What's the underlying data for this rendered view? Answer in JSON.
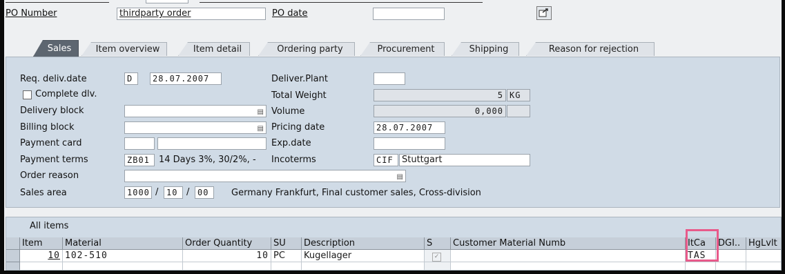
{
  "header": {
    "po_number_label": "PO Number",
    "po_number_value": "thirdparty order",
    "po_date_label": "PO date",
    "po_date_value": "",
    "toolbar_icon": "display-document-icon"
  },
  "tabs": [
    "Sales",
    "Item overview",
    "Item detail",
    "Ordering party",
    "Procurement",
    "Shipping",
    "Reason for rejection"
  ],
  "sales": {
    "req_deliv_date_label": "Req. deliv.date",
    "req_deliv_date_fmt": "D",
    "req_deliv_date_value": "28.07.2007",
    "complete_dlv_label": "Complete dlv.",
    "delivery_block_label": "Delivery block",
    "billing_block_label": "Billing block",
    "payment_card_label": "Payment card",
    "payment_terms_label": "Payment terms",
    "payment_terms_code": "ZB01",
    "payment_terms_text": "14 Days 3%, 30/2%, -",
    "order_reason_label": "Order reason",
    "sales_area_label": "Sales area",
    "sales_org": "1000",
    "distr_channel": "10",
    "division": "00",
    "sep": "/",
    "sales_area_text": "Germany Frankfurt, Final customer sales, Cross-division",
    "deliver_plant_label": "Deliver.Plant",
    "total_weight_label": "Total Weight",
    "total_weight_value": "5",
    "weight_unit": "KG",
    "volume_label": "Volume",
    "volume_value": "0,000",
    "pricing_date_label": "Pricing date",
    "pricing_date_value": "28.07.2007",
    "exp_date_label": "Exp.date",
    "incoterms_label": "Incoterms",
    "incoterms_code": "CIF",
    "incoterms_place": "Stuttgart"
  },
  "items": {
    "title": "All items",
    "columns": [
      "Item",
      "Material",
      "Order Quantity",
      "SU",
      "Description",
      "S",
      "Customer Material Numb",
      "ItCa",
      "DGI..",
      "HgLvlt"
    ],
    "rows": [
      {
        "item": "10",
        "material": "102-510",
        "qty": "10",
        "su": "PC",
        "description": "Kugellager",
        "itca": "TAS"
      }
    ]
  }
}
